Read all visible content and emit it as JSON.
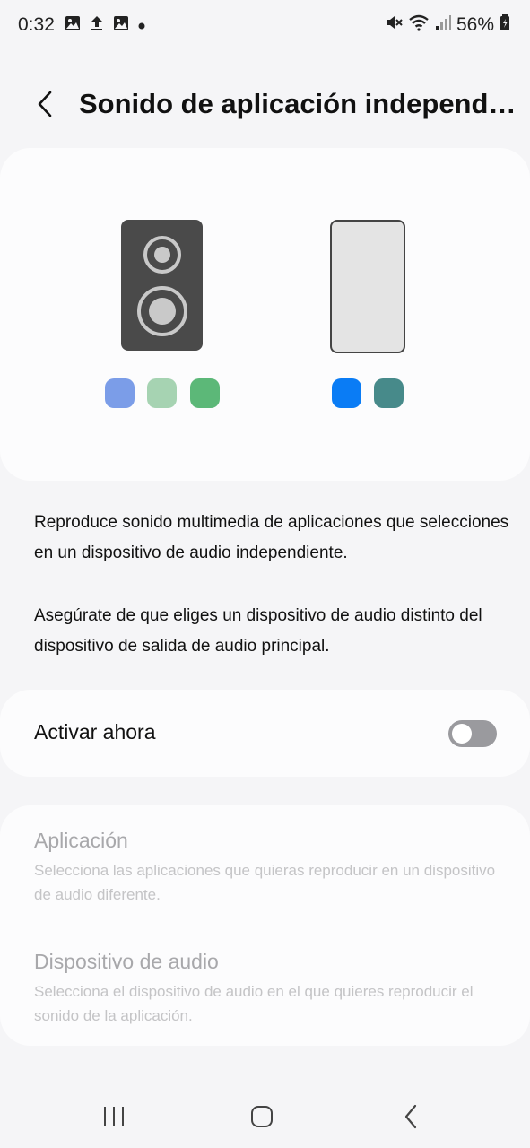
{
  "status_bar": {
    "time": "0:32",
    "battery": "56%",
    "icons_left": [
      "image-icon",
      "upload-icon",
      "image-icon",
      "dot-icon"
    ],
    "icons_right": [
      "mute-icon",
      "wifi-icon",
      "signal-icon",
      "battery-icon"
    ]
  },
  "header": {
    "title": "Sonido de aplicación independiente"
  },
  "illustration": {
    "speaker_dots": [
      "#7b9de8",
      "#a6d3b2",
      "#5cb878"
    ],
    "phone_dots": [
      "#0a7cf5",
      "#478a8a"
    ]
  },
  "description": {
    "paragraph1": "Reproduce sonido multimedia de aplicaciones que selecciones en un dispositivo de audio independiente.",
    "paragraph2": "Asegúrate de que eliges un dispositivo de audio distinto del dispositivo de salida de audio principal."
  },
  "toggle": {
    "label": "Activar ahora",
    "state": "off"
  },
  "settings": {
    "app": {
      "title": "Aplicación",
      "subtitle": "Selecciona las aplicaciones que quieras reproducir en un dispositivo de audio diferente."
    },
    "device": {
      "title": "Dispositivo de audio",
      "subtitle": "Selecciona el dispositivo de audio en el que quieres reproducir el sonido de la aplicación."
    }
  },
  "nav_bar": {
    "buttons": [
      "recents-icon",
      "home-icon",
      "back-icon"
    ]
  }
}
